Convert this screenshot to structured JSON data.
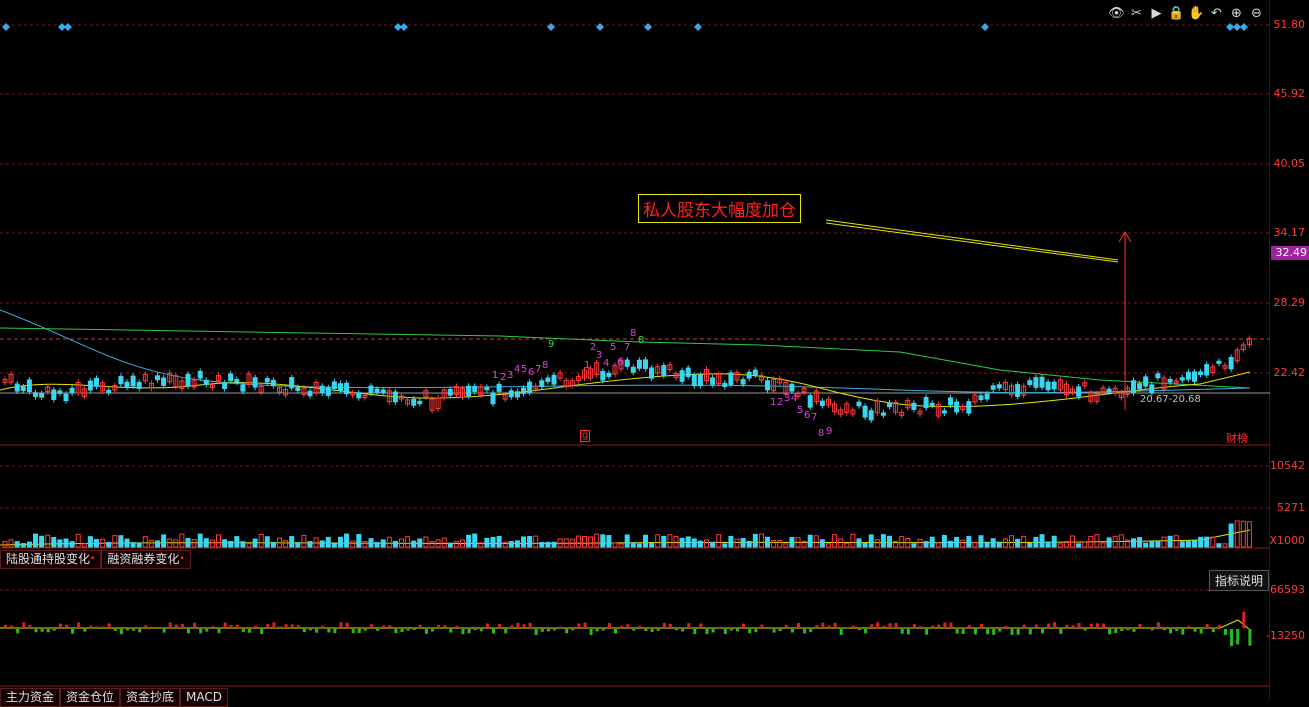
{
  "price_axis": [
    "51.80",
    "45.92",
    "40.05",
    "34.17",
    "28.29",
    "22.42"
  ],
  "current_price": "32.49",
  "volume_axis": [
    "10542",
    "5271",
    "X1000"
  ],
  "macd_axis": [
    "66593",
    "-13250"
  ],
  "annotation": "私人股东大幅度加仓",
  "low_label": "20.67-20.68",
  "marker_g": "g",
  "caibang": "财榜",
  "tabs_mid": [
    {
      "label": "陆股通持股变化",
      "dot": "•"
    },
    {
      "label": "融资融券变化",
      "dot": "•"
    }
  ],
  "indicator_button": "指标说明",
  "tabs_bottom": [
    "主力资金",
    "资金仓位",
    "资金抄底",
    "MACD"
  ],
  "toolbar_icons": [
    "eye-icon",
    "scissors-icon",
    "play-icon",
    "lock-icon",
    "hand-icon",
    "back-icon",
    "zoom-in-icon",
    "zoom-out-icon"
  ],
  "colors": {
    "up": "#ff3b3b",
    "down": "#3ad6f0",
    "ma_yellow": "#e6e600",
    "ma_green": "#2ecc40",
    "ma_blue": "#3ab0e0",
    "tdx_magenta": "#e040e0",
    "tdx_green": "#3adc3a"
  }
}
